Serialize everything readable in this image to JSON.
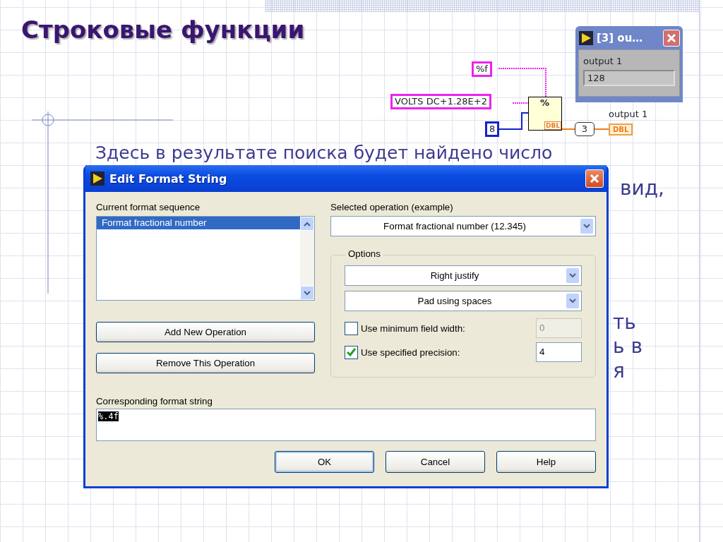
{
  "slide": {
    "title": "Строковые функции",
    "text_line": "Здесь в результате поиска будет найдено число",
    "text_fragments": [
      "вид,",
      "ть",
      "ь в",
      "я"
    ]
  },
  "diagram": {
    "constants": [
      {
        "value": "%f",
        "kind": "string"
      },
      {
        "value": "VOLTS DC+1.28E+2",
        "kind": "string"
      },
      {
        "value": "8",
        "kind": "number"
      }
    ],
    "function": {
      "glyph": "%",
      "output_type": "DBL"
    },
    "index": "3",
    "indicator": {
      "label": "output 1",
      "type": "DBL"
    }
  },
  "output_window": {
    "title": "[3] ou…",
    "label": "output 1",
    "value": "128"
  },
  "dialog": {
    "title": "Edit Format String",
    "sequence_label": "Current format sequence",
    "sequence_items": [
      {
        "label": "Format fractional number",
        "selected": true
      }
    ],
    "add_button": "Add New Operation",
    "remove_button": "Remove This Operation",
    "operation_label": "Selected operation (example)",
    "operation": "Format fractional number (12.345)",
    "options_label": "Options",
    "dropdowns": [
      "Right justify",
      "Pad using spaces"
    ],
    "checks": [
      {
        "label": "Use minimum field width:",
        "checked": false,
        "value": "0",
        "disabled": true
      },
      {
        "label": "Use specified precision:",
        "checked": true,
        "value": "4",
        "disabled": false
      }
    ],
    "format_label": "Corresponding format string",
    "format_string": "%.4f",
    "buttons": [
      {
        "label": "OK",
        "default": true
      },
      {
        "label": "Cancel",
        "default": false
      },
      {
        "label": "Help",
        "default": false
      }
    ]
  }
}
